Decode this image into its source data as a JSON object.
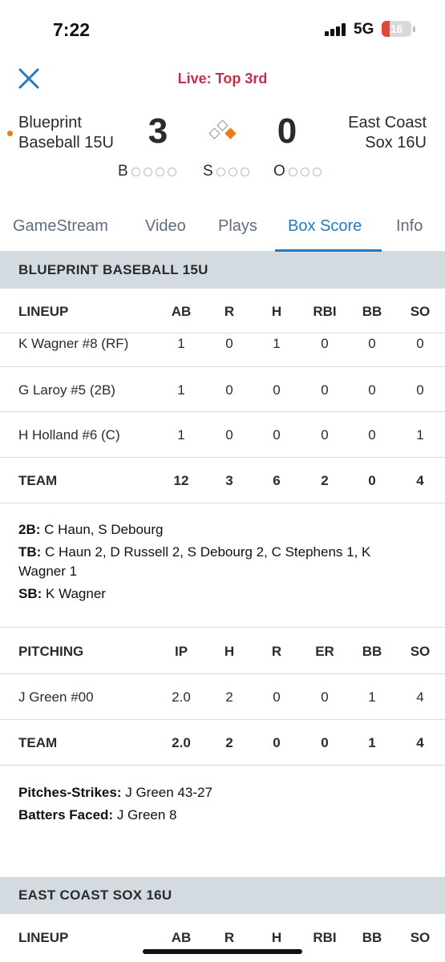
{
  "status_bar": {
    "time": "7:22",
    "network": "5G",
    "battery": "16"
  },
  "header": {
    "live_status": "Live: Top 3rd"
  },
  "scoreboard": {
    "away_team": "Blueprint\nBaseball 15U",
    "home_team": "East Coast\nSox 16U",
    "away_score": "3",
    "home_score": "0",
    "count": {
      "balls_label": "B",
      "strikes_label": "S",
      "outs_label": "O"
    }
  },
  "tabs": [
    {
      "label": "GameStream"
    },
    {
      "label": "Video"
    },
    {
      "label": "Plays"
    },
    {
      "label": "Box Score"
    },
    {
      "label": "Info"
    }
  ],
  "active_tab": "Box Score",
  "team1": {
    "name": "BLUEPRINT BASEBALL 15U",
    "lineup_header": [
      "LINEUP",
      "AB",
      "R",
      "H",
      "RBI",
      "BB",
      "SO"
    ],
    "lineup_rows": [
      {
        "name": "K Wagner #8 (RF)",
        "AB": "1",
        "R": "0",
        "H": "1",
        "RBI": "0",
        "BB": "0",
        "SO": "0"
      },
      {
        "name": "G Laroy #5 (2B)",
        "AB": "1",
        "R": "0",
        "H": "0",
        "RBI": "0",
        "BB": "0",
        "SO": "0"
      },
      {
        "name": "H Holland #6 (C)",
        "AB": "1",
        "R": "0",
        "H": "0",
        "RBI": "0",
        "BB": "0",
        "SO": "1"
      }
    ],
    "lineup_total": {
      "name": "TEAM",
      "AB": "12",
      "R": "3",
      "H": "6",
      "RBI": "2",
      "BB": "0",
      "SO": "4"
    },
    "batting_notes": {
      "doubles_label": "2B:",
      "doubles_value": " C Haun, S Debourg",
      "total_bases_label": "TB:",
      "total_bases_value": " C Haun 2, D Russell 2, S Debourg 2, C Stephens 1, K Wagner 1",
      "stolen_bases_label": "SB:",
      "stolen_bases_value": " K Wagner"
    },
    "pitching_header": [
      "PITCHING",
      "IP",
      "H",
      "R",
      "ER",
      "BB",
      "SO"
    ],
    "pitching_rows": [
      {
        "name": "J Green #00",
        "IP": "2.0",
        "H": "2",
        "R": "0",
        "ER": "0",
        "BB": "1",
        "SO": "4"
      }
    ],
    "pitching_total": {
      "name": "TEAM",
      "IP": "2.0",
      "H": "2",
      "R": "0",
      "ER": "0",
      "BB": "1",
      "SO": "4"
    },
    "pitching_notes": {
      "pitches_label": "Pitches-Strikes:",
      "pitches_value": " J Green 43-27",
      "batters_label": "Batters Faced:",
      "batters_value": " J Green 8"
    }
  },
  "team2": {
    "name": "EAST COAST SOX 16U",
    "lineup_header": [
      "LINEUP",
      "AB",
      "R",
      "H",
      "RBI",
      "BB",
      "SO"
    ]
  },
  "colors": {
    "live": "#c62f4b",
    "accent": "#1f7cc4",
    "runner_base": "#f07b1a",
    "section_header_bg": "#d3dbe1"
  }
}
